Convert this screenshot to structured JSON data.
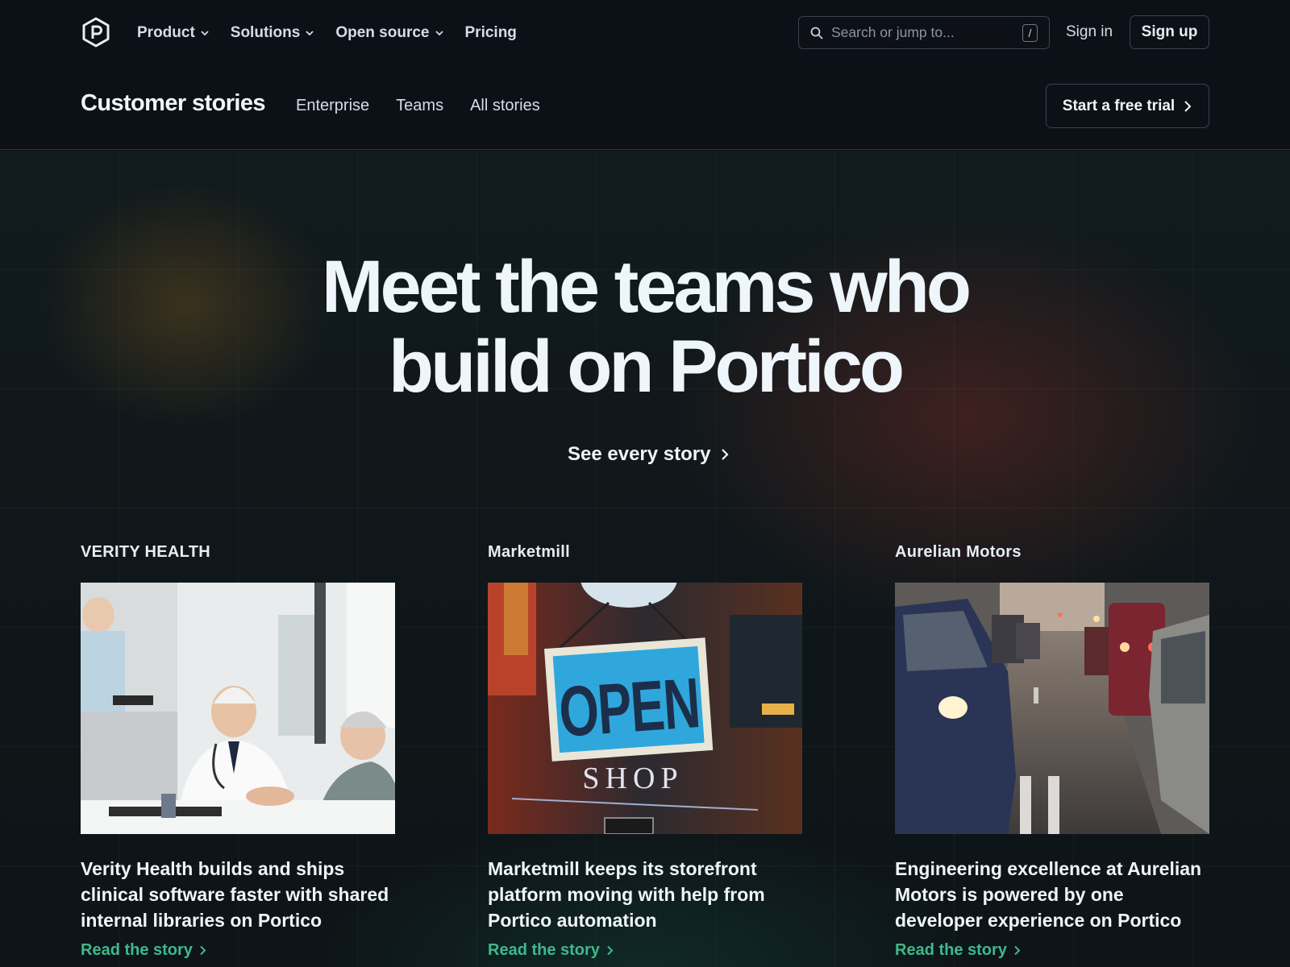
{
  "topnav": {
    "logo_icon": "portico-hexagon-logo-icon",
    "items": [
      {
        "label": "Product",
        "has_dropdown": true
      },
      {
        "label": "Solutions",
        "has_dropdown": true
      },
      {
        "label": "Open source",
        "has_dropdown": true
      },
      {
        "label": "Pricing",
        "has_dropdown": false
      }
    ],
    "search": {
      "placeholder": "Search or jump to...",
      "value": "",
      "shortcut": "/"
    },
    "signin_label": "Sign in",
    "signup_label": "Sign up"
  },
  "subnav": {
    "title": "Customer stories",
    "links": [
      "Enterprise",
      "Teams",
      "All stories"
    ],
    "cta_label": "Start a free trial"
  },
  "hero": {
    "title_line1": "Meet the teams who",
    "title_line2": "build on Portico",
    "link_label": "See every story"
  },
  "stories": [
    {
      "brand": "VERITY HEALTH",
      "image": "doctor-consultation-photo",
      "headline": "Verity Health builds and ships clinical software faster with shared internal libraries on Portico",
      "link": "Read the story"
    },
    {
      "brand": "Marketmill",
      "image": "open-shop-sign-photo",
      "image_sign_text": "OPEN",
      "image_sign_subtext": "SHOP",
      "headline": "Marketmill keeps its storefront platform moving with help from Portico automation",
      "link": "Read the story"
    },
    {
      "brand": "Aurelian Motors",
      "image": "traffic-cars-photo",
      "headline": "Engineering excellence at Aurelian Motors is powered by one developer experience on Portico",
      "link": "Read the story"
    }
  ],
  "colors": {
    "background": "#0d1117",
    "text": "#e6edf3",
    "accent_link": "#3fb98a",
    "border": "#3a424c"
  }
}
